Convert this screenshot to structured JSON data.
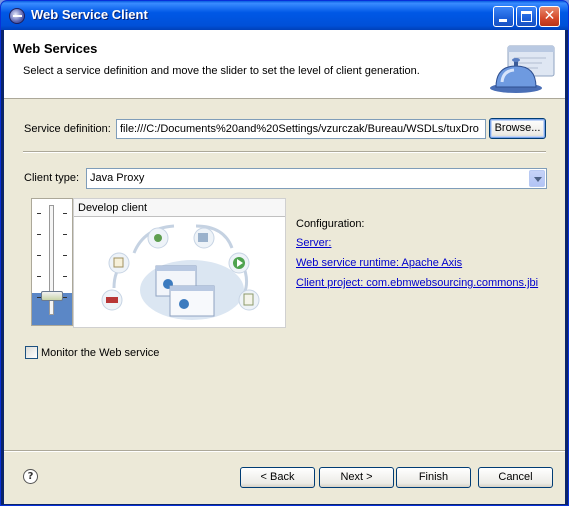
{
  "window": {
    "title": "Web Service Client",
    "controls": {
      "minimize": "minimize",
      "maximize": "maximize",
      "close": "close"
    }
  },
  "header": {
    "title": "Web Services",
    "description": "Select a service definition and move the slider to set the level of client generation."
  },
  "service_definition": {
    "label": "Service definition:",
    "value": "file:///C:/Documents%20and%20Settings/vzurczak/Bureau/WSDLs/tuxDro",
    "browse_label": "Browse..."
  },
  "client_type": {
    "label": "Client type:",
    "selected": "Java Proxy"
  },
  "slider": {
    "level_label": "Develop client",
    "level_fraction": 0.25
  },
  "configuration": {
    "heading": "Configuration:",
    "server_link": "Server: ",
    "runtime_link": "Web service runtime: Apache Axis",
    "project_link": "Client project: com.ebmwebsourcing.commons.jbi"
  },
  "monitor": {
    "label": "Monitor the Web service",
    "checked": false
  },
  "buttons": {
    "back": "< Back",
    "next": "Next >",
    "finish": "Finish",
    "cancel": "Cancel",
    "help": "?"
  },
  "colors": {
    "titlebar": "#0054e3",
    "dialog_bg": "#ece9d8",
    "link": "#0000cc"
  }
}
